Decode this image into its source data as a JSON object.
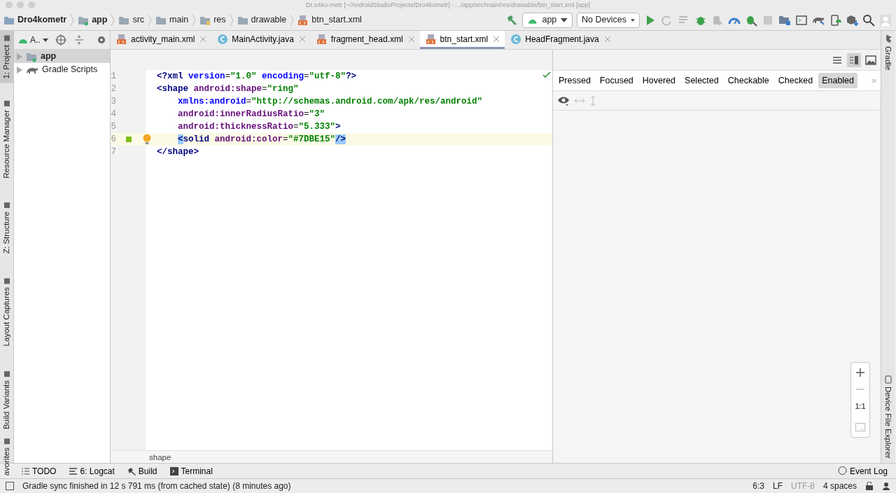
{
  "window": {
    "title": "Dr.o4ko-metr [~/AndroidStudioProjects/Dro4kometr] - .../app/src/main/res/drawable/btn_start.xml [app]"
  },
  "breadcrumbs": [
    {
      "label": "Dro4kometr",
      "kind": "project"
    },
    {
      "label": "app",
      "kind": "module"
    },
    {
      "label": "src",
      "kind": "folder"
    },
    {
      "label": "main",
      "kind": "folder"
    },
    {
      "label": "res",
      "kind": "res"
    },
    {
      "label": "drawable",
      "kind": "folder"
    },
    {
      "label": "btn_start.xml",
      "kind": "xml"
    }
  ],
  "run_config": "app",
  "device": "No Devices",
  "left_strip": [
    {
      "label": "1: Project",
      "selected": true
    },
    {
      "label": "Resource Manager",
      "selected": false
    },
    {
      "label": "Z: Structure",
      "selected": false
    },
    {
      "label": "Layout Captures",
      "selected": false
    },
    {
      "label": "Build Variants",
      "selected": false
    },
    {
      "label": "avorites",
      "selected": false
    }
  ],
  "right_strip": [
    {
      "label": "Gradle"
    },
    {
      "label": "Device File Explorer"
    }
  ],
  "project_panel": {
    "view": "A..",
    "tree": [
      {
        "label": "app",
        "kind": "module",
        "selected": true
      },
      {
        "label": "Gradle Scripts",
        "kind": "gradle",
        "selected": false
      }
    ]
  },
  "editor_tabs": [
    {
      "label": "activity_main.xml",
      "kind": "xml",
      "selected": false
    },
    {
      "label": "MainActivity.java",
      "kind": "class",
      "selected": false
    },
    {
      "label": "fragment_head.xml",
      "kind": "xml",
      "selected": false
    },
    {
      "label": "btn_start.xml",
      "kind": "xml",
      "selected": true
    },
    {
      "label": "HeadFragment.java",
      "kind": "class",
      "selected": false
    }
  ],
  "code_lines": [
    {
      "number": "1",
      "indented": false,
      "current": false,
      "bulb": false,
      "tokens": [
        {
          "t": "<?xml",
          "kind": "tag"
        },
        {
          "t": " version",
          "kind": "xattr"
        },
        {
          "t": "=",
          "kind": "plain"
        },
        {
          "t": "\"1.0\"",
          "kind": "value"
        },
        {
          "t": " encoding",
          "kind": "xattr"
        },
        {
          "t": "=",
          "kind": "plain"
        },
        {
          "t": "\"utf-8\"",
          "kind": "value"
        },
        {
          "t": "?>",
          "kind": "tag"
        }
      ]
    },
    {
      "number": "2",
      "indented": false,
      "current": false,
      "bulb": false,
      "tokens": [
        {
          "t": "<shape",
          "kind": "tag"
        },
        {
          "t": " android:shape",
          "kind": "attr"
        },
        {
          "t": "=",
          "kind": "plain"
        },
        {
          "t": "\"ring\"",
          "kind": "value"
        }
      ]
    },
    {
      "number": "3",
      "indented": true,
      "current": false,
      "bulb": false,
      "tokens": [
        {
          "t": "xmlns:android",
          "kind": "xattr"
        },
        {
          "t": "=",
          "kind": "plain"
        },
        {
          "t": "\"http://schemas.android.com/apk/res/android\"",
          "kind": "value"
        }
      ]
    },
    {
      "number": "4",
      "indented": true,
      "current": false,
      "bulb": false,
      "tokens": [
        {
          "t": "android:innerRadiusRatio",
          "kind": "attr"
        },
        {
          "t": "=",
          "kind": "plain"
        },
        {
          "t": "\"3\"",
          "kind": "value"
        }
      ]
    },
    {
      "number": "5",
      "indented": true,
      "current": false,
      "bulb": false,
      "tokens": [
        {
          "t": "android:thicknessRatio",
          "kind": "attr"
        },
        {
          "t": "=",
          "kind": "plain"
        },
        {
          "t": "\"5.333\"",
          "kind": "value"
        },
        {
          "t": ">",
          "kind": "tag"
        }
      ]
    },
    {
      "number": "6",
      "indented": true,
      "current": true,
      "bulb": true,
      "color": "#7dbe15",
      "tokens": [
        {
          "t": "<",
          "kind": "match"
        },
        {
          "t": "solid",
          "kind": "tag"
        },
        {
          "t": " android:color",
          "kind": "attr"
        },
        {
          "t": "=",
          "kind": "plain"
        },
        {
          "t": "\"#7DBE15\"",
          "kind": "value"
        },
        {
          "t": "/>",
          "kind": "match"
        }
      ]
    },
    {
      "number": "7",
      "indented": false,
      "current": false,
      "bulb": false,
      "tokens": [
        {
          "t": "</shape>",
          "kind": "tag"
        }
      ]
    }
  ],
  "preview": {
    "states": [
      {
        "label": "Pressed",
        "selected": false
      },
      {
        "label": "Focused",
        "selected": false
      },
      {
        "label": "Hovered",
        "selected": false
      },
      {
        "label": "Selected",
        "selected": false
      },
      {
        "label": "Checkable",
        "selected": false
      },
      {
        "label": "Checked",
        "selected": false
      },
      {
        "label": "Enabled",
        "selected": true
      }
    ],
    "more": "»",
    "zoom_reset": "1:1"
  },
  "editor_breadcrumb": "shape",
  "tool_windows": [
    {
      "label": "TODO",
      "kind": "todo"
    },
    {
      "label": "6: Logcat",
      "kind": "logcat"
    },
    {
      "label": "Build",
      "kind": "build"
    },
    {
      "label": "Terminal",
      "kind": "terminal"
    }
  ],
  "event_log": "Event Log",
  "status": {
    "message": "Gradle sync finished in 12 s 791 ms (from cached state) (8 minutes ago)",
    "position": "6:3",
    "line_separator": "LF",
    "encoding": "UTF-8",
    "indent": "4 spaces"
  }
}
